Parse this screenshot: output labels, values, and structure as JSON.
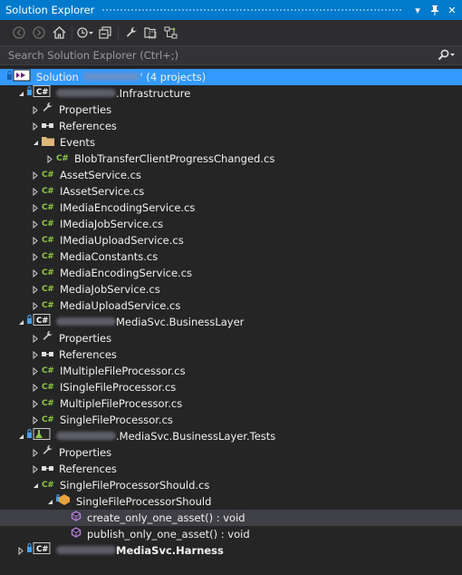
{
  "window": {
    "title": "Solution Explorer",
    "pin_glyph": "▾",
    "autohide_glyph": "⊥",
    "close_glyph": "✕"
  },
  "search": {
    "placeholder": "Search Solution Explorer (Ctrl+;)"
  },
  "solution": {
    "prefix": "Solution ",
    "suffix": "' (4 projects)"
  },
  "projects": [
    {
      "name": ".Infrastructure"
    },
    {
      "name": "MediaSvc.BusinessLayer"
    },
    {
      "name": ".MediaSvc.BusinessLayer.Tests"
    },
    {
      "name": "MediaSvc.Harness"
    }
  ],
  "items": {
    "properties": "Properties",
    "references": "References",
    "events": "Events",
    "blob": "BlobTransferClientProgressChanged.cs",
    "asset_service": "AssetService.cs",
    "iasset_service": "IAssetService.cs",
    "imedia_encoding": "IMediaEncodingService.cs",
    "imedia_job": "IMediaJobService.cs",
    "imedia_upload": "IMediaUploadService.cs",
    "media_constants": "MediaConstants.cs",
    "media_encoding": "MediaEncodingService.cs",
    "media_job": "MediaJobService.cs",
    "media_upload": "MediaUploadService.cs",
    "imultiple": "IMultipleFileProcessor.cs",
    "isingle": "ISingleFileProcessor.cs",
    "multiple": "MultipleFileProcessor.cs",
    "single": "SingleFileProcessor.cs",
    "single_should_file": "SingleFileProcessorShould.cs",
    "single_should_class": "SingleFileProcessorShould",
    "method1": "create_only_one_asset() : void",
    "method2": "publish_only_one_asset() : void"
  },
  "icon_text": {
    "cs": "C#"
  },
  "colors": {
    "accent": "#007acc",
    "selection": "#3399ff",
    "cs_green": "#8ec843",
    "method_purple": "#b180d7"
  }
}
